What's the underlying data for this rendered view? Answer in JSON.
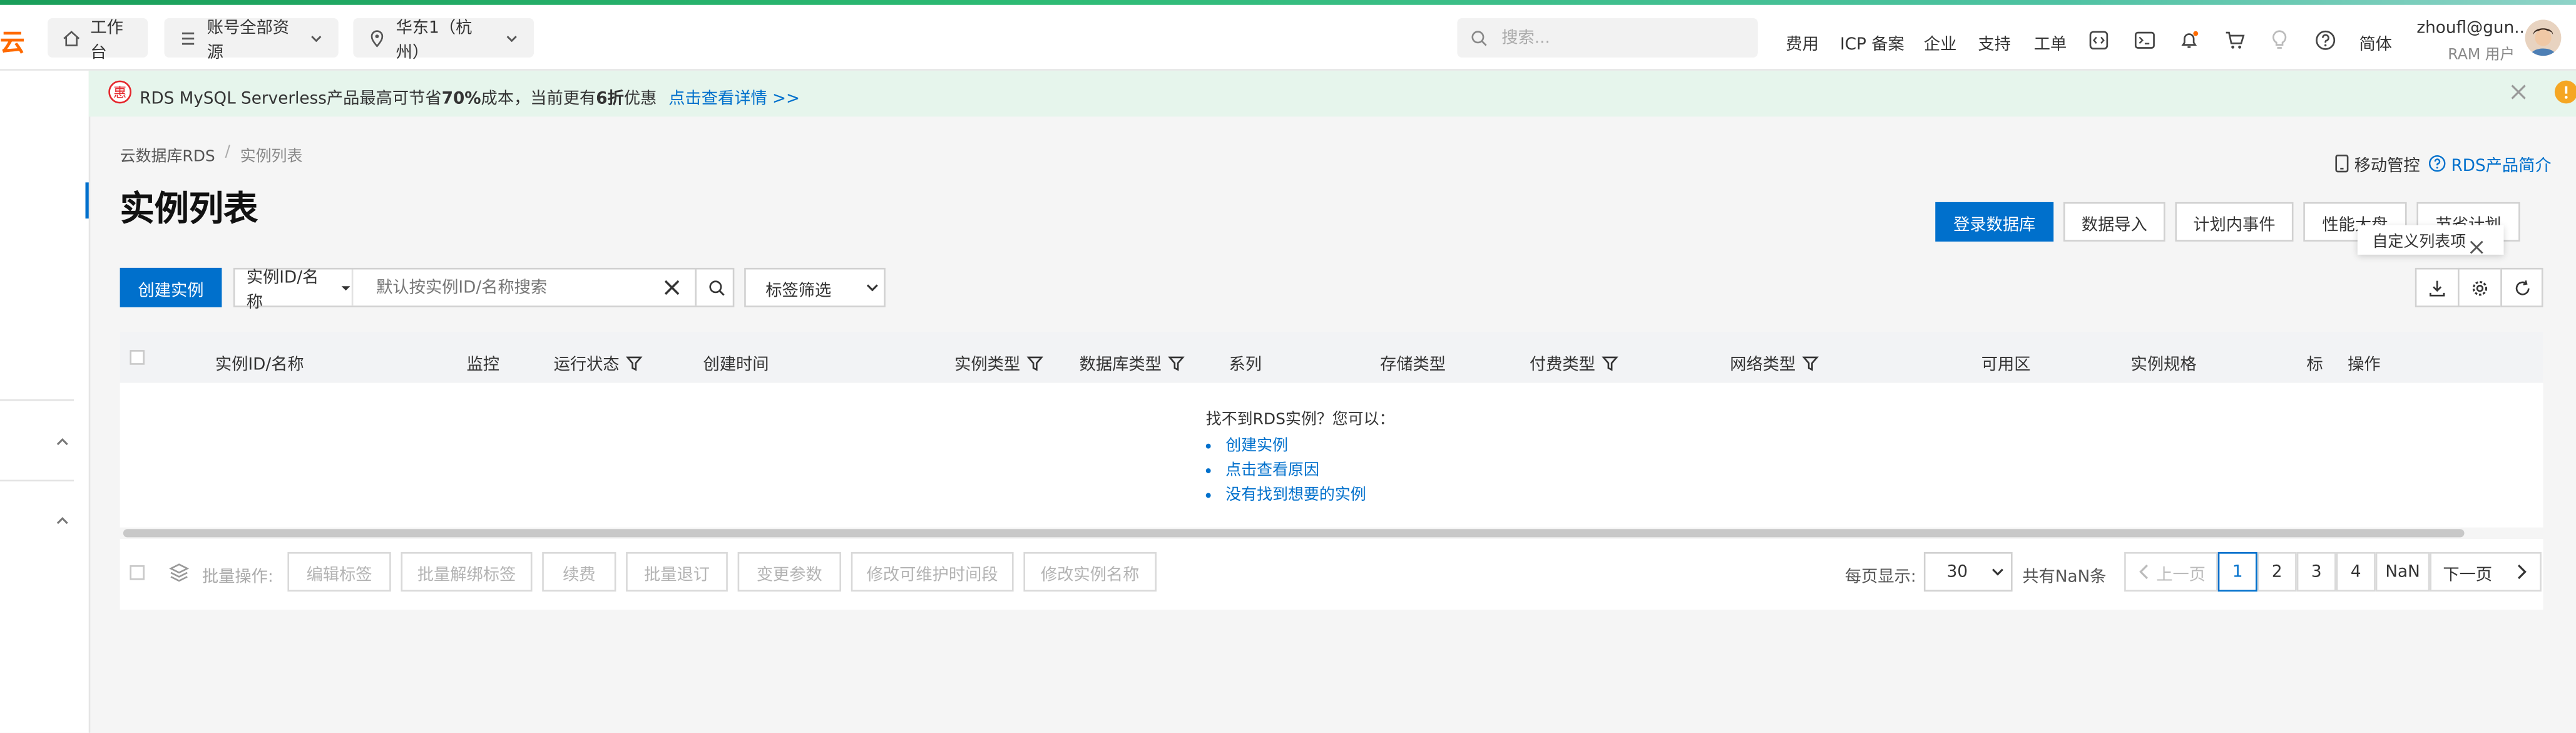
{
  "topbar": {
    "logo": "云",
    "workbench": "工作台",
    "account_resources": "账号全部资源",
    "region": "华东1（杭州）",
    "search_placeholder": "搜索...",
    "nav_links": [
      "费用",
      "ICP 备案",
      "企业",
      "支持",
      "工单"
    ],
    "language": "简体",
    "user_name": "zhoufl@gun...",
    "user_role": "RAM 用户"
  },
  "banner": {
    "badge": "惠",
    "text_1": "RDS MySQL Serverless产品最高可节省",
    "text_bold_1": "70%",
    "text_2": "成本，当前更有",
    "text_bold_2": "6折",
    "text_3": "优惠",
    "link": "点击查看详情 >>"
  },
  "breadcrumb": {
    "item_1": "云数据库RDS",
    "separator": "/",
    "item_2": "实例列表"
  },
  "page": {
    "title": "实例列表",
    "mobile_control": "移动管控",
    "product_intro": "RDS产品简介"
  },
  "actions": {
    "login_db": "登录数据库",
    "data_import": "数据导入",
    "scheduled_events": "计划内事件",
    "performance": "性能大盘",
    "savings_plan": "节省计划"
  },
  "tooltip": {
    "text": "自定义列表项"
  },
  "toolbar": {
    "create_instance": "创建实例",
    "search_type": "实例ID/名称",
    "search_placeholder": "默认按实例ID/名称搜索",
    "tag_filter": "标签筛选"
  },
  "table": {
    "columns": [
      "实例ID/名称",
      "监控",
      "运行状态",
      "创建时间",
      "实例类型",
      "数据库类型",
      "系列",
      "存储类型",
      "付费类型",
      "网络类型",
      "可用区",
      "实例规格",
      "标",
      "操作"
    ],
    "empty_title": "找不到RDS实例？您可以：",
    "empty_links": [
      "创建实例",
      "点击查看原因",
      "没有找到想要的实例"
    ]
  },
  "batch": {
    "label": "批量操作:",
    "buttons": [
      "编辑标签",
      "批量解绑标签",
      "续费",
      "批量退订",
      "变更参数",
      "修改可维护时间段",
      "修改实例名称"
    ]
  },
  "pagination": {
    "per_page_label": "每页显示:",
    "per_page": "30",
    "total": "共有NaN条",
    "prev": "上一页",
    "pages": [
      "1",
      "2",
      "3",
      "4",
      "NaN"
    ],
    "current_page": "1",
    "next": "下一页"
  },
  "colors": {
    "primary": "#0070cc",
    "brand": "#ff6a00",
    "banner_bg": "#e6f5ec",
    "badge_red": "#e5262c"
  }
}
